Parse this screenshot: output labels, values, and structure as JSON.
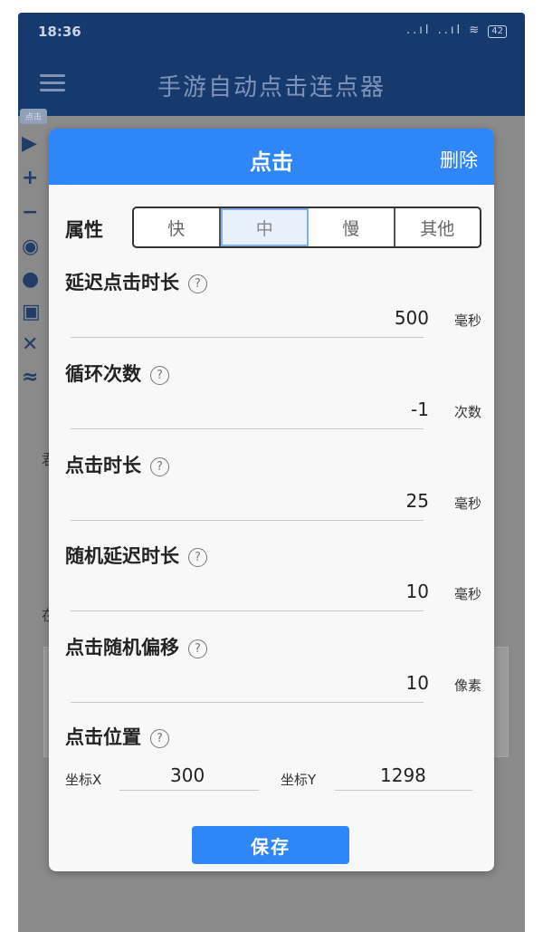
{
  "status_bar": {
    "time": "18:36",
    "signal": "..ıl ..ıl ≋",
    "battery": "42"
  },
  "app_bar": {
    "title": "手游自动点击连点器"
  },
  "background": {
    "tag": "点击",
    "glyphs": [
      "▶",
      "+",
      "−",
      "◉",
      "●",
      "▣",
      "✕",
      "≈"
    ],
    "text1": "在",
    "text2": "君"
  },
  "dialog": {
    "title": "点击",
    "delete_label": "删除",
    "attr_label": "属性",
    "attr_options": [
      "快",
      "中",
      "慢",
      "其他"
    ],
    "attr_selected": "中",
    "fields": [
      {
        "label": "延迟点击时长",
        "value": "500",
        "unit": "毫秒"
      },
      {
        "label": "循环次数",
        "value": "-1",
        "unit": "次数"
      },
      {
        "label": "点击时长",
        "value": "25",
        "unit": "毫秒"
      },
      {
        "label": "随机延迟时长",
        "value": "10",
        "unit": "毫秒"
      },
      {
        "label": "点击随机偏移",
        "value": "10",
        "unit": "像素"
      }
    ],
    "position": {
      "label": "点击位置",
      "x_label": "坐标X",
      "x_value": "300",
      "y_label": "坐标Y",
      "y_value": "1298"
    },
    "help_glyph": "?",
    "save_label": "保存"
  },
  "colors": {
    "primary": "#2f86f6",
    "app_bar": "#163a6e",
    "overlay": "#8a8a8a"
  }
}
